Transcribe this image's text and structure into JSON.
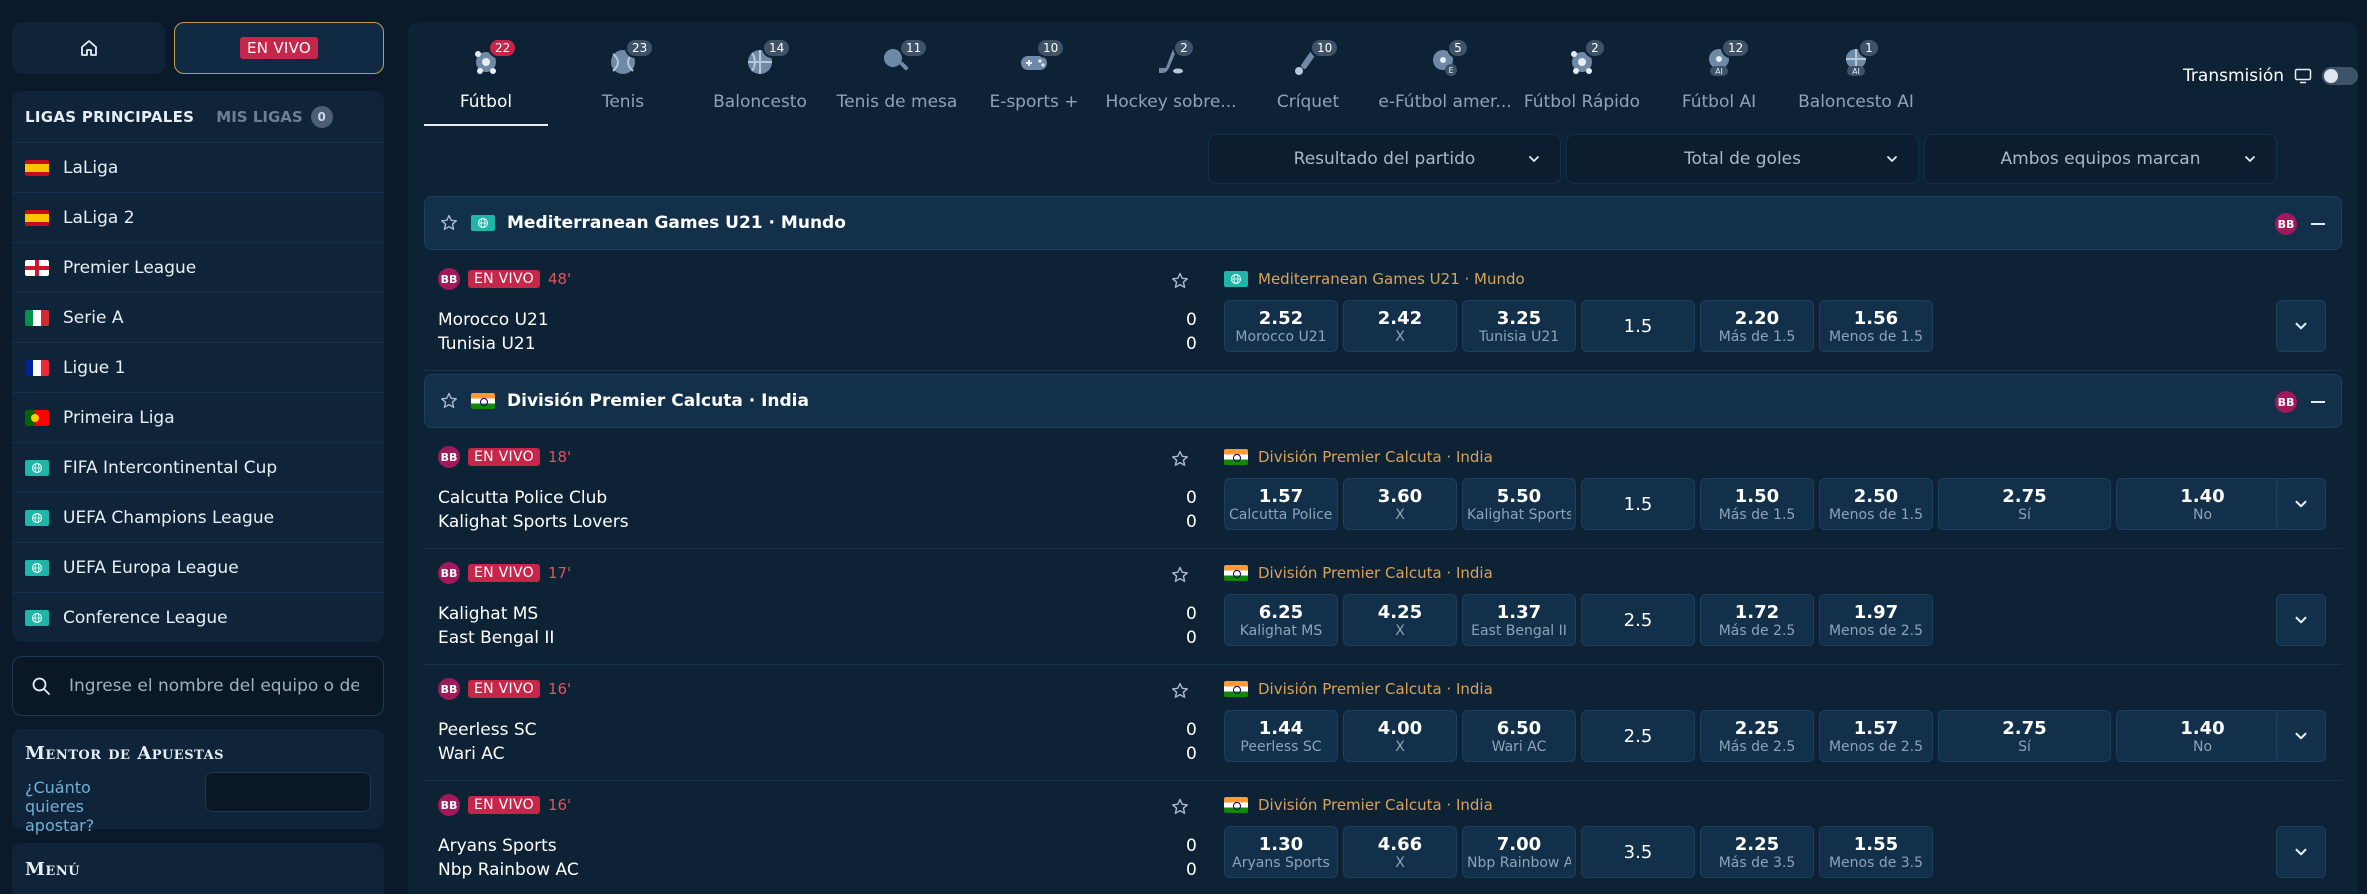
{
  "sidebar": {
    "live_label": "EN VIVO",
    "tab_main": "LIGAS PRINCIPALES",
    "tab_mine": "MIS LIGAS",
    "tab_mine_count": "0",
    "leagues": [
      {
        "name": "LaLiga",
        "flag": "es"
      },
      {
        "name": "LaLiga 2",
        "flag": "es"
      },
      {
        "name": "Premier League",
        "flag": "en"
      },
      {
        "name": "Serie A",
        "flag": "it"
      },
      {
        "name": "Ligue 1",
        "flag": "fr"
      },
      {
        "name": "Primeira Liga",
        "flag": "pt"
      },
      {
        "name": "FIFA Intercontinental Cup",
        "flag": "world"
      },
      {
        "name": "UEFA Champions League",
        "flag": "world"
      },
      {
        "name": "UEFA Europa League",
        "flag": "world"
      },
      {
        "name": "Conference League",
        "flag": "world"
      }
    ],
    "search_placeholder": "Ingrese el nombre del equipo o de...",
    "mentor_title": "Mentor de Apuestas",
    "mentor_question": "¿Cuánto quieres apostar?",
    "menu_title": "Menú"
  },
  "sports": [
    {
      "label": "Fútbol",
      "count": "22",
      "icon": "soccer-ball-icon",
      "active": true
    },
    {
      "label": "Tenis",
      "count": "23",
      "icon": "tennis-ball-icon"
    },
    {
      "label": "Baloncesto",
      "count": "14",
      "icon": "basketball-icon"
    },
    {
      "label": "Tenis de mesa",
      "count": "11",
      "icon": "table-tennis-icon"
    },
    {
      "label": "E-sports +",
      "count": "10",
      "icon": "gamepad-icon"
    },
    {
      "label": "Hockey sobre...",
      "count": "2",
      "icon": "hockey-icon"
    },
    {
      "label": "Críquet",
      "count": "10",
      "icon": "cricket-icon"
    },
    {
      "label": "e-Fútbol amer...",
      "count": "5",
      "icon": "efootball-icon"
    },
    {
      "label": "Fútbol Rápido",
      "count": "2",
      "icon": "soccer-ball-icon"
    },
    {
      "label": "Fútbol AI",
      "count": "12",
      "icon": "ai-soccer-icon"
    },
    {
      "label": "Baloncesto AI",
      "count": "1",
      "icon": "ai-basketball-icon"
    }
  ],
  "stream_label": "Transmisión",
  "markets": [
    "Resultado del partido",
    "Total de goles",
    "Ambos equipos marcan"
  ],
  "groups": [
    {
      "title": "Mediterranean Games U21 · Mundo",
      "flag": "world"
    },
    {
      "title": "División Premier Calcuta · India",
      "flag": "in"
    }
  ],
  "bb_label": "BB",
  "matches": [
    {
      "minute": "48'",
      "league": "Mediterranean Games U21 · Mundo",
      "flag": "world",
      "home": "Morocco U21",
      "away": "Tunisia U21",
      "home_score": "0",
      "away_score": "0",
      "odds": [
        {
          "v": "2.52",
          "s": "Morocco U21"
        },
        {
          "v": "2.42",
          "s": "X"
        },
        {
          "v": "3.25",
          "s": "Tunisia U21"
        },
        {
          "v": "1.5",
          "s": "",
          "total": true
        },
        {
          "v": "2.20",
          "s": "Más de 1.5"
        },
        {
          "v": "1.56",
          "s": "Menos de 1.5"
        }
      ]
    },
    {
      "minute": "18'",
      "league": "División Premier Calcuta · India",
      "flag": "in",
      "home": "Calcutta Police Club",
      "away": "Kalighat Sports Lovers",
      "home_score": "0",
      "away_score": "0",
      "odds": [
        {
          "v": "1.57",
          "s": "Calcutta Police Club"
        },
        {
          "v": "3.60",
          "s": "X"
        },
        {
          "v": "5.50",
          "s": "Kalighat Sports Lovers"
        },
        {
          "v": "1.5",
          "s": "",
          "total": true
        },
        {
          "v": "1.50",
          "s": "Más de 1.5"
        },
        {
          "v": "2.50",
          "s": "Menos de 1.5"
        },
        {
          "v": "2.75",
          "s": "Sí",
          "wide": true
        },
        {
          "v": "1.40",
          "s": "No",
          "wide": true
        }
      ]
    },
    {
      "minute": "17'",
      "league": "División Premier Calcuta · India",
      "flag": "in",
      "home": "Kalighat MS",
      "away": "East Bengal II",
      "home_score": "0",
      "away_score": "0",
      "odds": [
        {
          "v": "6.25",
          "s": "Kalighat MS"
        },
        {
          "v": "4.25",
          "s": "X"
        },
        {
          "v": "1.37",
          "s": "East Bengal II"
        },
        {
          "v": "2.5",
          "s": "",
          "total": true
        },
        {
          "v": "1.72",
          "s": "Más de 2.5"
        },
        {
          "v": "1.97",
          "s": "Menos de 2.5"
        }
      ]
    },
    {
      "minute": "16'",
      "league": "División Premier Calcuta · India",
      "flag": "in",
      "home": "Peerless SC",
      "away": "Wari AC",
      "home_score": "0",
      "away_score": "0",
      "odds": [
        {
          "v": "1.44",
          "s": "Peerless SC"
        },
        {
          "v": "4.00",
          "s": "X"
        },
        {
          "v": "6.50",
          "s": "Wari AC"
        },
        {
          "v": "2.5",
          "s": "",
          "total": true
        },
        {
          "v": "2.25",
          "s": "Más de 2.5"
        },
        {
          "v": "1.57",
          "s": "Menos de 2.5"
        },
        {
          "v": "2.75",
          "s": "Sí",
          "wide": true
        },
        {
          "v": "1.40",
          "s": "No",
          "wide": true
        }
      ]
    },
    {
      "minute": "16'",
      "league": "División Premier Calcuta · India",
      "flag": "in",
      "home": "Aryans Sports",
      "away": "Nbp Rainbow AC",
      "home_score": "0",
      "away_score": "0",
      "odds": [
        {
          "v": "1.30",
          "s": "Aryans Sports"
        },
        {
          "v": "4.66",
          "s": "X"
        },
        {
          "v": "7.00",
          "s": "Nbp Rainbow AC"
        },
        {
          "v": "3.5",
          "s": "",
          "total": true
        },
        {
          "v": "2.25",
          "s": "Más de 3.5"
        },
        {
          "v": "1.55",
          "s": "Menos de 3.5"
        }
      ]
    }
  ]
}
